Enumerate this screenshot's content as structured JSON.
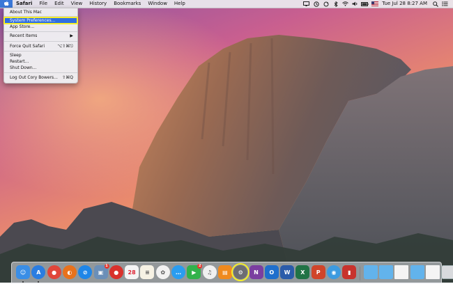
{
  "menubar": {
    "apple_icon": "apple-logo-icon",
    "app_name": "Safari",
    "menus": [
      "File",
      "Edit",
      "View",
      "History",
      "Bookmarks",
      "Window",
      "Help"
    ],
    "status": {
      "date_time": "Tue Jul 28  8:27 AM",
      "icons": [
        "airplay-display-icon",
        "time-machine-icon",
        "sync-icon",
        "bluetooth-icon",
        "wifi-icon",
        "volume-icon",
        "battery-icon",
        "input-flag-icon",
        "spotlight-search-icon",
        "notification-center-icon"
      ]
    }
  },
  "apple_menu": {
    "items": [
      {
        "label": "About This Mac",
        "shortcut": ""
      },
      {
        "label": "System Preferences...",
        "shortcut": "",
        "highlighted": true
      },
      {
        "label": "App Store...",
        "shortcut": ""
      },
      {
        "label": "Recent Items",
        "shortcut": "▶"
      },
      {
        "label": "Force Quit Safari",
        "shortcut": "⌥⇧⌘⎋"
      },
      {
        "label": "Sleep",
        "shortcut": ""
      },
      {
        "label": "Restart...",
        "shortcut": ""
      },
      {
        "label": "Shut Down...",
        "shortcut": ""
      },
      {
        "label": "Log Out Cory Bowers...",
        "shortcut": "⇧⌘Q"
      }
    ]
  },
  "dock": {
    "apps": [
      {
        "name": "finder-icon",
        "color": "#3a8ee6",
        "glyph": "☺"
      },
      {
        "name": "app-store-icon",
        "color": "#2a7de1",
        "glyph": "A"
      },
      {
        "name": "chrome-icon",
        "color": "#e0463a",
        "glyph": "●"
      },
      {
        "name": "firefox-icon",
        "color": "#e8721c",
        "glyph": "◐"
      },
      {
        "name": "safari-icon",
        "color": "#1f86e8",
        "glyph": "⊘"
      },
      {
        "name": "preview-icon",
        "color": "#6b8fb8",
        "glyph": "▣",
        "badge": "1"
      },
      {
        "name": "photo-booth-icon",
        "color": "#d9312c",
        "glyph": "●"
      },
      {
        "name": "calendar-icon",
        "color": "#f4f4f4",
        "glyph": "28"
      },
      {
        "name": "notes-icon",
        "color": "#f6f2e4",
        "glyph": "≡"
      },
      {
        "name": "photos-icon",
        "color": "#f2f2f2",
        "glyph": "✿"
      },
      {
        "name": "messages-icon",
        "color": "#2a9df0",
        "glyph": "…"
      },
      {
        "name": "facetime-icon",
        "color": "#31b24b",
        "glyph": "▶",
        "badge": "2"
      },
      {
        "name": "itunes-icon",
        "color": "#f0f0f0",
        "glyph": "♫"
      },
      {
        "name": "ibooks-icon",
        "color": "#f08a1e",
        "glyph": "▤"
      },
      {
        "name": "system-preferences-icon",
        "color": "#6d6d72",
        "glyph": "⚙",
        "highlighted": true
      },
      {
        "name": "onenote-icon",
        "color": "#7b3ea0",
        "glyph": "N"
      },
      {
        "name": "outlook-icon",
        "color": "#1f6fcc",
        "glyph": "O"
      },
      {
        "name": "word-icon",
        "color": "#2b5caa",
        "glyph": "W"
      },
      {
        "name": "excel-icon",
        "color": "#217346",
        "glyph": "X"
      },
      {
        "name": "powerpoint-icon",
        "color": "#d0452a",
        "glyph": "P"
      },
      {
        "name": "network-utility-icon",
        "color": "#3d9be0",
        "glyph": "◉"
      },
      {
        "name": "keynote-icon",
        "color": "#c8332d",
        "glyph": "▮"
      }
    ],
    "stacks": [
      {
        "name": "applications-folder-icon",
        "color": "#62b3ec"
      },
      {
        "name": "documents-folder-icon",
        "color": "#62b3ec"
      },
      {
        "name": "document-stack-icon",
        "color": "#f4f4f4"
      },
      {
        "name": "downloads-folder-icon",
        "color": "#62b3ec"
      },
      {
        "name": "file-stack-icon",
        "color": "#f4f4f4"
      },
      {
        "name": "trash-icon",
        "color": "#d8dadd"
      }
    ]
  }
}
